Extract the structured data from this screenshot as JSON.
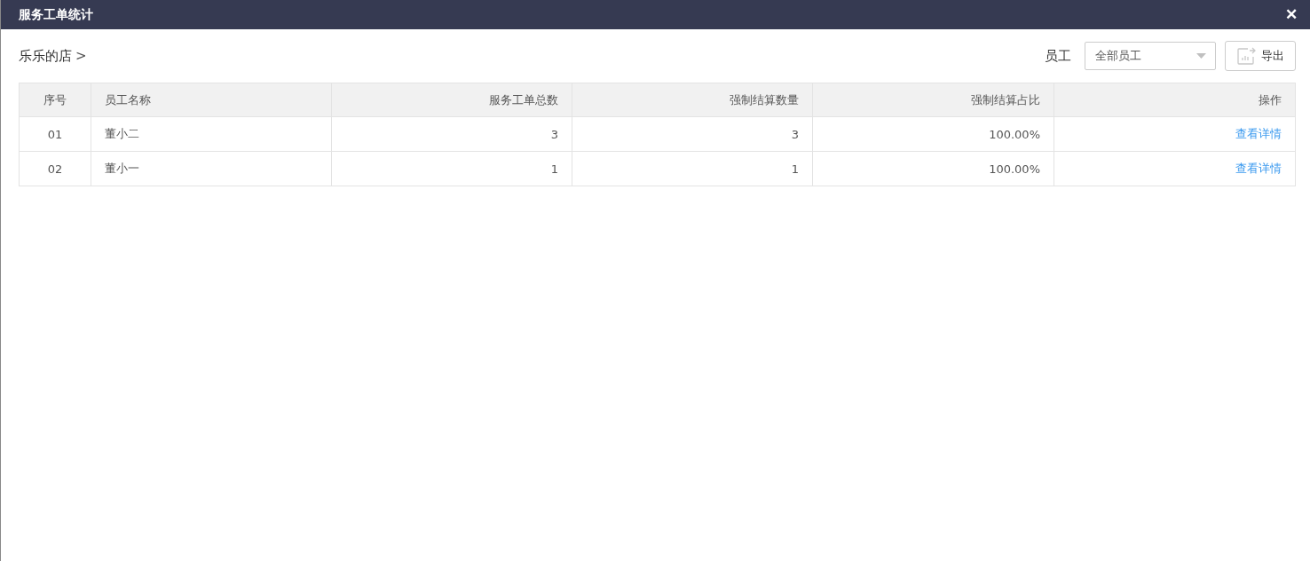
{
  "window": {
    "title": "服务工单统计",
    "close": "✕"
  },
  "breadcrumb": {
    "store": "乐乐的店",
    "chevron": ">"
  },
  "filter": {
    "label": "员工",
    "value": "全部员工"
  },
  "export_button": {
    "label": "导出"
  },
  "table": {
    "columns": [
      "序号",
      "员工名称",
      "服务工单总数",
      "强制结算数量",
      "强制结算占比",
      "操作"
    ],
    "rows": [
      {
        "cells": [
          "01",
          "董小二",
          "3",
          "3",
          "100.00%"
        ],
        "action": "查看详情"
      },
      {
        "cells": [
          "02",
          "董小一",
          "1",
          "1",
          "100.00%"
        ],
        "action": "查看详情"
      }
    ]
  }
}
